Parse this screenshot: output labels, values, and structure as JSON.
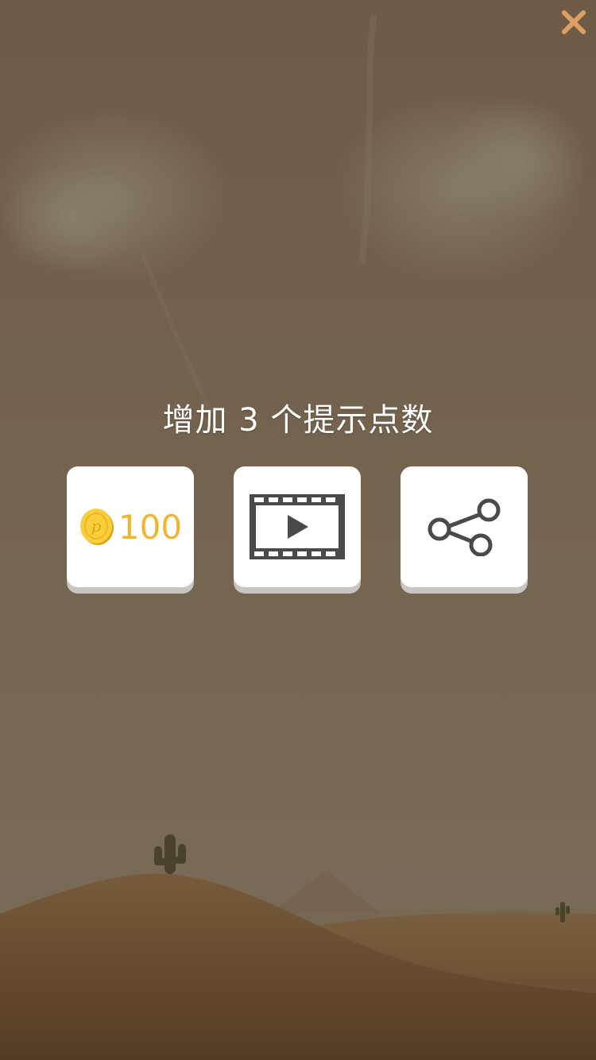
{
  "dialog": {
    "title": "增加 3 个提示点数"
  },
  "options": {
    "coin": {
      "amount": "100"
    },
    "video": {},
    "share": {}
  },
  "colors": {
    "close": "#e0a063",
    "coin_text": "#f1b52e",
    "icon_dark": "#4a4a4a",
    "card": "#ffffff",
    "card_shadow": "#c9c6c1"
  }
}
